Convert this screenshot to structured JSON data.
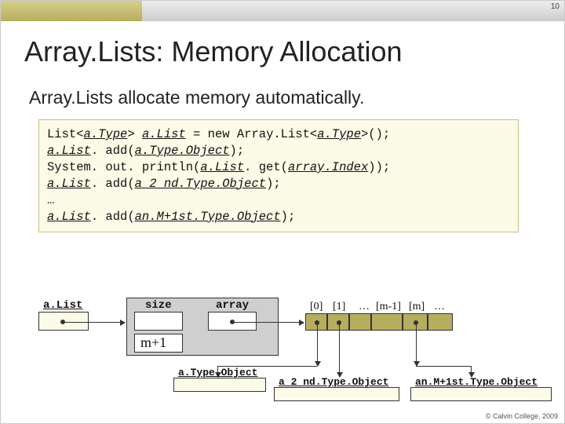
{
  "page_number": "10",
  "title": "Array.Lists: Memory Allocation",
  "subtitle": "Array.Lists allocate memory automatically.",
  "code": {
    "l1a": "List<",
    "l1b": "a.Type",
    "l1c": "> ",
    "l1d": "a.List",
    "l1e": " = new Array.List<",
    "l1f": "a.Type",
    "l1g": ">();",
    "l2a": "a.List",
    "l2b": ". add(",
    "l2c": "a.Type.Object",
    "l2d": ");",
    "l3a": "System. out. println(",
    "l3b": "a.List",
    "l3c": ". get(",
    "l3d": "array.Index",
    "l3e": "));",
    "l4a": "a.List",
    "l4b": ". add(",
    "l4c": "a 2 nd.Type.Object",
    "l4d": ");",
    "l5": "…",
    "l6a": "a.List",
    "l6b": ". add(",
    "l6c": "an.M+1st.Type.Object",
    "l6d": ");"
  },
  "diagram": {
    "alist": "a.List",
    "size": "size",
    "array": "array",
    "mplus1": "m+1",
    "idx0": "[0]",
    "idx1": "[1]",
    "idxdots": "…",
    "idxm1": "[m-1]",
    "idxm": "[m]",
    "idxtail": "…",
    "obj1": "a.Type.Object",
    "obj2": "a 2 nd.Type.Object",
    "obj3": "an.M+1st.Type.Object"
  },
  "copyright": "© Calvin College, 2009"
}
